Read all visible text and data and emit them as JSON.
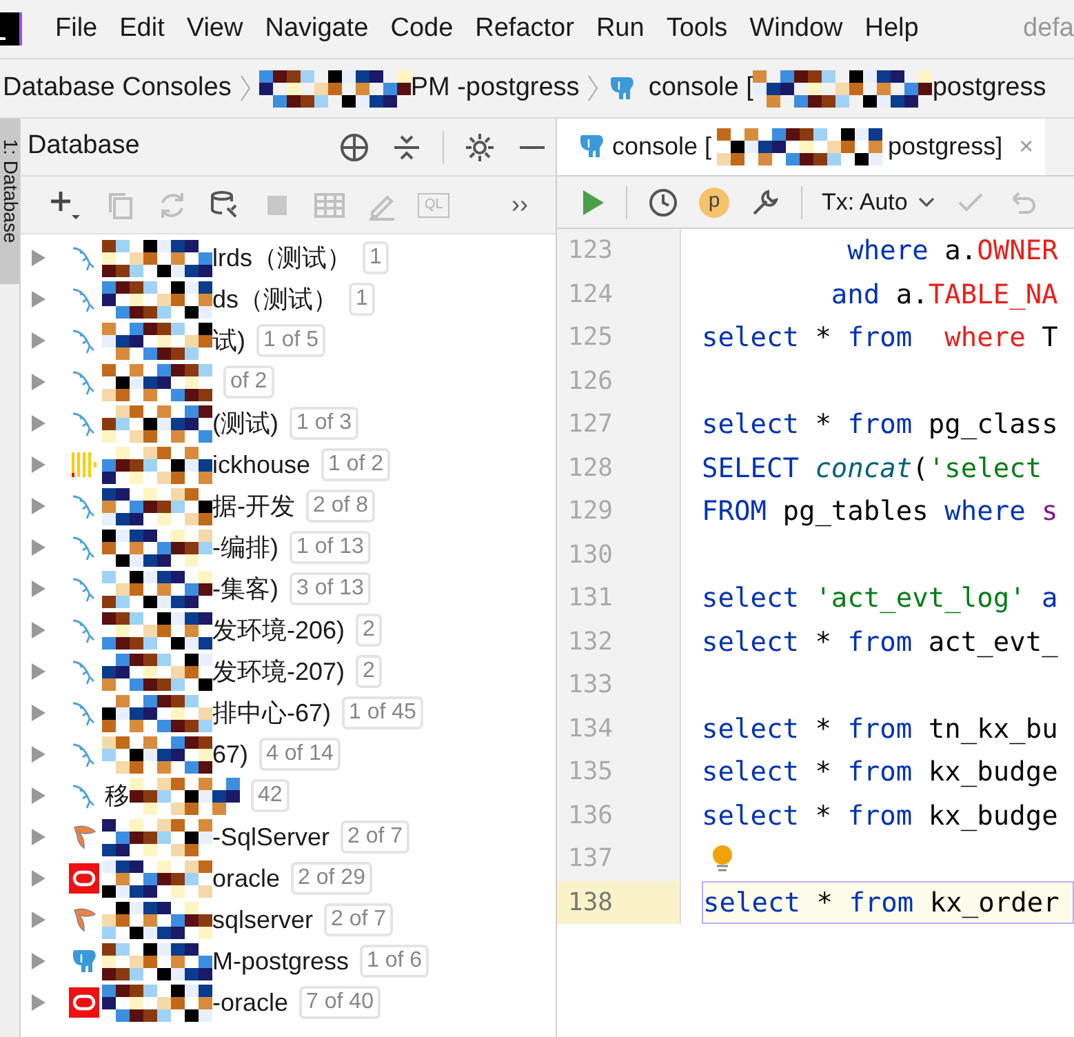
{
  "menu": {
    "items": [
      "File",
      "Edit",
      "View",
      "Navigate",
      "Code",
      "Refactor",
      "Run",
      "Tools",
      "Window",
      "Help"
    ],
    "window_title": "defa"
  },
  "breadcrumb": [
    {
      "kind": "text",
      "text": "Database Consoles"
    },
    {
      "kind": "masked",
      "text": "PM -postgress"
    },
    {
      "kind": "console",
      "text": "console [",
      "tail": "postgress"
    }
  ],
  "side_stripe": {
    "label": "1: Database",
    "selected": true
  },
  "database_panel": {
    "title": "Database",
    "toolbar": [
      {
        "kind": "add",
        "disabled": false
      },
      {
        "kind": "copy",
        "disabled": true
      },
      {
        "kind": "refresh",
        "disabled": true
      },
      {
        "kind": "db-tools",
        "disabled": false
      },
      {
        "kind": "stop",
        "disabled": true
      },
      {
        "kind": "table",
        "disabled": true
      },
      {
        "kind": "edit",
        "disabled": true
      },
      {
        "kind": "ql",
        "disabled": true,
        "text": "QL"
      },
      {
        "kind": "more",
        "disabled": false,
        "text": "››"
      }
    ],
    "tree": [
      {
        "kind": "mysql",
        "text": "lrds（测试）",
        "badge": "1"
      },
      {
        "kind": "mysql",
        "text": "ds（测试）",
        "badge": "1"
      },
      {
        "kind": "mysql",
        "text": "试)",
        "badge": "1 of 5"
      },
      {
        "kind": "mysql",
        "badge": "of 2"
      },
      {
        "kind": "mysql",
        "text": "(测试)",
        "badge": "1 of 3"
      },
      {
        "kind": "clickhouse",
        "text": "ickhouse",
        "badge": "1 of 2"
      },
      {
        "kind": "mysql",
        "text": "据-开发",
        "badge": "2 of 8"
      },
      {
        "kind": "mysql",
        "text": "-编排)",
        "badge": "1 of 13"
      },
      {
        "kind": "mysql",
        "text": "-集客)",
        "badge": "3 of 13"
      },
      {
        "kind": "mysql",
        "text": "发环境-206)",
        "badge": "2"
      },
      {
        "kind": "mysql",
        "text": "发环境-207)",
        "badge": "2"
      },
      {
        "kind": "mysql",
        "text": "排中心-67)",
        "badge": "1 of 45"
      },
      {
        "kind": "mysql",
        "text": "67)",
        "badge": "4 of 14"
      },
      {
        "kind": "mysql",
        "prefix": "移",
        "badge": "42"
      },
      {
        "kind": "sqlserver",
        "text": "-SqlServer",
        "badge": "2 of 7"
      },
      {
        "kind": "oracle",
        "text": "oracle",
        "badge": "2 of 29"
      },
      {
        "kind": "sqlserver",
        "text": "sqlserver",
        "badge": "2 of 7"
      },
      {
        "kind": "postgres",
        "text": "M-postgress",
        "badge": "1 of 6"
      },
      {
        "kind": "oracle",
        "text": "-oracle",
        "badge": "7 of 40"
      }
    ]
  },
  "editor": {
    "tab": {
      "text": "console [",
      "tail": "postgress]",
      "close": "×",
      "selected": true
    },
    "toolbar": {
      "profile": "p",
      "tx": "Tx: Auto"
    },
    "lines": [
      {
        "number": "123",
        "kind": "plain",
        "current": false,
        "tokens": [
          {
            "kind": "kw",
            "text": "         where"
          },
          {
            "kind": "plain",
            "text": " a."
          },
          {
            "kind": "red",
            "text": "OWNER"
          }
        ]
      },
      {
        "number": "124",
        "kind": "fold_end",
        "current": false,
        "tokens": [
          {
            "kind": "kw",
            "text": "        and"
          },
          {
            "kind": "plain",
            "text": " a."
          },
          {
            "kind": "red",
            "text": "TABLE_NA"
          }
        ]
      },
      {
        "number": "125",
        "kind": "plain",
        "current": false,
        "tokens": [
          {
            "kind": "kw",
            "text": "select"
          },
          {
            "kind": "plain",
            "text": " * "
          },
          {
            "kind": "kw",
            "text": "from"
          },
          {
            "kind": "red",
            "text": "  where"
          },
          {
            "kind": "plain",
            "text": " T"
          }
        ]
      },
      {
        "number": "126",
        "kind": "plain",
        "current": false
      },
      {
        "number": "127",
        "kind": "plain",
        "current": false,
        "tokens": [
          {
            "kind": "kw",
            "text": "select"
          },
          {
            "kind": "plain",
            "text": " * "
          },
          {
            "kind": "kw",
            "text": "from"
          },
          {
            "kind": "plain",
            "text": " pg_class"
          }
        ]
      },
      {
        "number": "128",
        "kind": "fold_start",
        "current": false,
        "tokens": [
          {
            "kind": "kw",
            "text": "SELECT "
          },
          {
            "kind": "func",
            "text": "concat"
          },
          {
            "kind": "plain",
            "text": "("
          },
          {
            "kind": "string",
            "text": "'select"
          }
        ]
      },
      {
        "number": "129",
        "kind": "fold_end",
        "current": false,
        "tokens": [
          {
            "kind": "kw",
            "text": "FROM"
          },
          {
            "kind": "plain",
            "text": " pg_tables "
          },
          {
            "kind": "kw",
            "text": "where"
          },
          {
            "kind": "purple",
            "text": " s"
          }
        ]
      },
      {
        "number": "130",
        "kind": "plain",
        "current": false
      },
      {
        "number": "131",
        "kind": "plain",
        "current": false,
        "tokens": [
          {
            "kind": "kw",
            "text": "select "
          },
          {
            "kind": "string",
            "text": "'act_evt_log'"
          },
          {
            "kind": "kw",
            "text": " a"
          }
        ]
      },
      {
        "number": "132",
        "kind": "plain",
        "current": false,
        "tokens": [
          {
            "kind": "kw",
            "text": "select"
          },
          {
            "kind": "plain",
            "text": " * "
          },
          {
            "kind": "kw",
            "text": "from"
          },
          {
            "kind": "plain",
            "text": " act_evt_"
          }
        ]
      },
      {
        "number": "133",
        "kind": "plain",
        "current": false
      },
      {
        "number": "134",
        "kind": "plain",
        "current": false,
        "tokens": [
          {
            "kind": "kw",
            "text": "select"
          },
          {
            "kind": "plain",
            "text": " * "
          },
          {
            "kind": "kw",
            "text": "from"
          },
          {
            "kind": "plain",
            "text": " tn_kx_bu"
          }
        ]
      },
      {
        "number": "135",
        "kind": "plain",
        "current": false,
        "tokens": [
          {
            "kind": "kw",
            "text": "select"
          },
          {
            "kind": "plain",
            "text": " * "
          },
          {
            "kind": "kw",
            "text": "from"
          },
          {
            "kind": "plain",
            "text": " kx_budge"
          }
        ]
      },
      {
        "number": "136",
        "kind": "plain",
        "current": false,
        "tokens": [
          {
            "kind": "kw",
            "text": "select"
          },
          {
            "kind": "plain",
            "text": " * "
          },
          {
            "kind": "kw",
            "text": "from"
          },
          {
            "kind": "plain",
            "text": " kx_budge"
          }
        ]
      },
      {
        "number": "137",
        "kind": "bulb",
        "current": false
      },
      {
        "number": "138",
        "kind": "plain",
        "current": true,
        "tokens": [
          {
            "kind": "kw",
            "text": "select"
          },
          {
            "kind": "plain",
            "text": " * "
          },
          {
            "kind": "kw",
            "text": "from"
          },
          {
            "kind": "plain",
            "text": " kx_order"
          }
        ]
      }
    ]
  }
}
